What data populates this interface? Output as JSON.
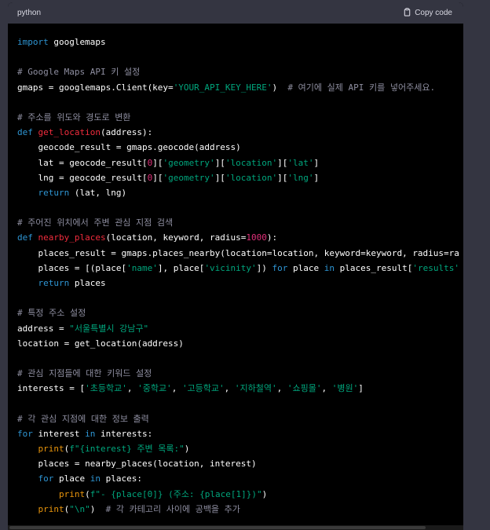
{
  "code_block": {
    "language": "python",
    "copy_label": "Copy code",
    "colors": {
      "keyword": "#2e95d3",
      "function": "#f22c3d",
      "string": "#00a67d",
      "number": "#df3079",
      "comment": "#8e8ea0",
      "builtin": "#e9950c"
    },
    "lines": [
      [
        {
          "t": "kw",
          "v": "import"
        },
        {
          "t": "plain",
          "v": " googlemaps"
        }
      ],
      [],
      [
        {
          "t": "cmt",
          "v": "# Google Maps API 키 설정"
        }
      ],
      [
        {
          "t": "plain",
          "v": "gmaps = googlemaps.Client(key="
        },
        {
          "t": "str",
          "v": "'YOUR_API_KEY_HERE'"
        },
        {
          "t": "plain",
          "v": ")  "
        },
        {
          "t": "cmt",
          "v": "# 여기에 실제 API 키를 넣어주세요."
        }
      ],
      [],
      [
        {
          "t": "cmt",
          "v": "# 주소를 위도와 경도로 변환"
        }
      ],
      [
        {
          "t": "kw",
          "v": "def"
        },
        {
          "t": "plain",
          "v": " "
        },
        {
          "t": "fn",
          "v": "get_location"
        },
        {
          "t": "plain",
          "v": "(address):"
        }
      ],
      [
        {
          "t": "plain",
          "v": "    geocode_result = gmaps.geocode(address)"
        }
      ],
      [
        {
          "t": "plain",
          "v": "    lat = geocode_result["
        },
        {
          "t": "num",
          "v": "0"
        },
        {
          "t": "plain",
          "v": "]["
        },
        {
          "t": "str",
          "v": "'geometry'"
        },
        {
          "t": "plain",
          "v": "]["
        },
        {
          "t": "str",
          "v": "'location'"
        },
        {
          "t": "plain",
          "v": "]["
        },
        {
          "t": "str",
          "v": "'lat'"
        },
        {
          "t": "plain",
          "v": "]"
        }
      ],
      [
        {
          "t": "plain",
          "v": "    lng = geocode_result["
        },
        {
          "t": "num",
          "v": "0"
        },
        {
          "t": "plain",
          "v": "]["
        },
        {
          "t": "str",
          "v": "'geometry'"
        },
        {
          "t": "plain",
          "v": "]["
        },
        {
          "t": "str",
          "v": "'location'"
        },
        {
          "t": "plain",
          "v": "]["
        },
        {
          "t": "str",
          "v": "'lng'"
        },
        {
          "t": "plain",
          "v": "]"
        }
      ],
      [
        {
          "t": "plain",
          "v": "    "
        },
        {
          "t": "kw",
          "v": "return"
        },
        {
          "t": "plain",
          "v": " (lat, lng)"
        }
      ],
      [],
      [
        {
          "t": "cmt",
          "v": "# 주어진 위치에서 주변 관심 지점 검색"
        }
      ],
      [
        {
          "t": "kw",
          "v": "def"
        },
        {
          "t": "plain",
          "v": " "
        },
        {
          "t": "fn",
          "v": "nearby_places"
        },
        {
          "t": "plain",
          "v": "(location, keyword, radius="
        },
        {
          "t": "num",
          "v": "1000"
        },
        {
          "t": "plain",
          "v": "):"
        }
      ],
      [
        {
          "t": "plain",
          "v": "    places_result = gmaps.places_nearby(location=location, keyword=keyword, radius=ra"
        }
      ],
      [
        {
          "t": "plain",
          "v": "    places = [(place["
        },
        {
          "t": "str",
          "v": "'name'"
        },
        {
          "t": "plain",
          "v": "], place["
        },
        {
          "t": "str",
          "v": "'vicinity'"
        },
        {
          "t": "plain",
          "v": "]) "
        },
        {
          "t": "kw",
          "v": "for"
        },
        {
          "t": "plain",
          "v": " place "
        },
        {
          "t": "kw",
          "v": "in"
        },
        {
          "t": "plain",
          "v": " places_result["
        },
        {
          "t": "str",
          "v": "'results'"
        }
      ],
      [
        {
          "t": "plain",
          "v": "    "
        },
        {
          "t": "kw",
          "v": "return"
        },
        {
          "t": "plain",
          "v": " places"
        }
      ],
      [],
      [
        {
          "t": "cmt",
          "v": "# 특정 주소 설정"
        }
      ],
      [
        {
          "t": "plain",
          "v": "address = "
        },
        {
          "t": "str",
          "v": "\"서울특별시 강남구\""
        }
      ],
      [
        {
          "t": "plain",
          "v": "location = get_location(address)"
        }
      ],
      [],
      [
        {
          "t": "cmt",
          "v": "# 관심 지점들에 대한 키워드 설정"
        }
      ],
      [
        {
          "t": "plain",
          "v": "interests = ["
        },
        {
          "t": "str",
          "v": "'초등학교'"
        },
        {
          "t": "plain",
          "v": ", "
        },
        {
          "t": "str",
          "v": "'중학교'"
        },
        {
          "t": "plain",
          "v": ", "
        },
        {
          "t": "str",
          "v": "'고등학교'"
        },
        {
          "t": "plain",
          "v": ", "
        },
        {
          "t": "str",
          "v": "'지하철역'"
        },
        {
          "t": "plain",
          "v": ", "
        },
        {
          "t": "str",
          "v": "'쇼핑몰'"
        },
        {
          "t": "plain",
          "v": ", "
        },
        {
          "t": "str",
          "v": "'병원'"
        },
        {
          "t": "plain",
          "v": "]"
        }
      ],
      [],
      [
        {
          "t": "cmt",
          "v": "# 각 관심 지점에 대한 정보 출력"
        }
      ],
      [
        {
          "t": "kw",
          "v": "for"
        },
        {
          "t": "plain",
          "v": " interest "
        },
        {
          "t": "kw",
          "v": "in"
        },
        {
          "t": "plain",
          "v": " interests:"
        }
      ],
      [
        {
          "t": "plain",
          "v": "    "
        },
        {
          "t": "bi",
          "v": "print"
        },
        {
          "t": "plain",
          "v": "("
        },
        {
          "t": "str",
          "v": "f\"{interest} 주변 목록:\""
        },
        {
          "t": "plain",
          "v": ")"
        }
      ],
      [
        {
          "t": "plain",
          "v": "    places = nearby_places(location, interest)"
        }
      ],
      [
        {
          "t": "plain",
          "v": "    "
        },
        {
          "t": "kw",
          "v": "for"
        },
        {
          "t": "plain",
          "v": " place "
        },
        {
          "t": "kw",
          "v": "in"
        },
        {
          "t": "plain",
          "v": " places:"
        }
      ],
      [
        {
          "t": "plain",
          "v": "        "
        },
        {
          "t": "bi",
          "v": "print"
        },
        {
          "t": "plain",
          "v": "("
        },
        {
          "t": "str",
          "v": "f\"- {place[0]} (주소: {place[1]})\""
        },
        {
          "t": "plain",
          "v": ")"
        }
      ],
      [
        {
          "t": "plain",
          "v": "    "
        },
        {
          "t": "bi",
          "v": "print"
        },
        {
          "t": "plain",
          "v": "("
        },
        {
          "t": "str",
          "v": "\"\\n\""
        },
        {
          "t": "plain",
          "v": ")  "
        },
        {
          "t": "cmt",
          "v": "# 각 카테고리 사이에 공백을 추가"
        }
      ]
    ]
  }
}
